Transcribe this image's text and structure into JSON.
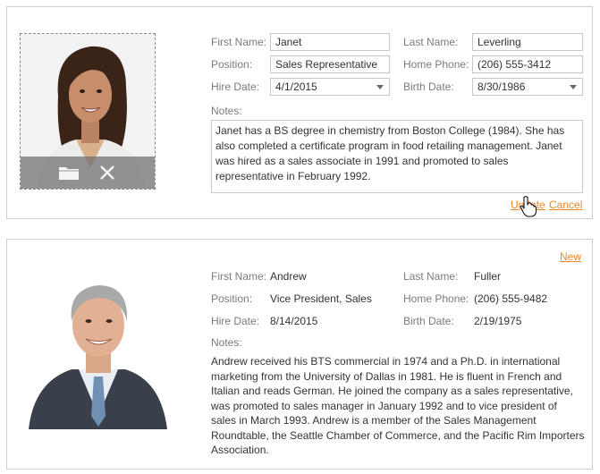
{
  "editor": {
    "first_name_label": "First Name:",
    "first_name_value": "Janet",
    "last_name_label": "Last Name:",
    "last_name_value": "Leverling",
    "position_label": "Position:",
    "position_value": "Sales Representative",
    "home_phone_label": "Home Phone:",
    "home_phone_value": "(206) 555-3412",
    "hire_date_label": "Hire Date:",
    "hire_date_value": "4/1/2015",
    "birth_date_label": "Birth Date:",
    "birth_date_value": "8/30/1986",
    "notes_label": "Notes:",
    "notes_value": "Janet has a BS degree in chemistry from Boston College (1984).  She has also completed a certificate program in food retailing management.  Janet was hired as a sales associate in 1991 and promoted to sales representative in February 1992.",
    "update_label": "Update",
    "cancel_label": "Cancel",
    "photo_icons": [
      "folder-icon",
      "close-icon"
    ]
  },
  "viewer": {
    "new_label": "New",
    "first_name_label": "First Name:",
    "first_name_value": "Andrew",
    "last_name_label": "Last Name:",
    "last_name_value": "Fuller",
    "position_label": "Position:",
    "position_value": "Vice President, Sales",
    "home_phone_label": "Home Phone:",
    "home_phone_value": "(206) 555-9482",
    "hire_date_label": "Hire Date:",
    "hire_date_value": "8/14/2015",
    "birth_date_label": "Birth Date:",
    "birth_date_value": "2/19/1975",
    "notes_label": "Notes:",
    "notes_value": "Andrew received his BTS commercial in 1974 and a Ph.D. in international marketing from the University of Dallas in 1981. He is fluent in French and Italian and reads German. He joined the company as a sales representative, was promoted to sales manager in January 1992 and to vice president of sales in March 1993. Andrew is a member of the Sales Management Roundtable, the Seattle Chamber of Commerce, and the Pacific Rim Importers Association."
  },
  "colors": {
    "link": "#e8862a",
    "border": "#cfcfcf",
    "label": "#7b7b7b"
  }
}
